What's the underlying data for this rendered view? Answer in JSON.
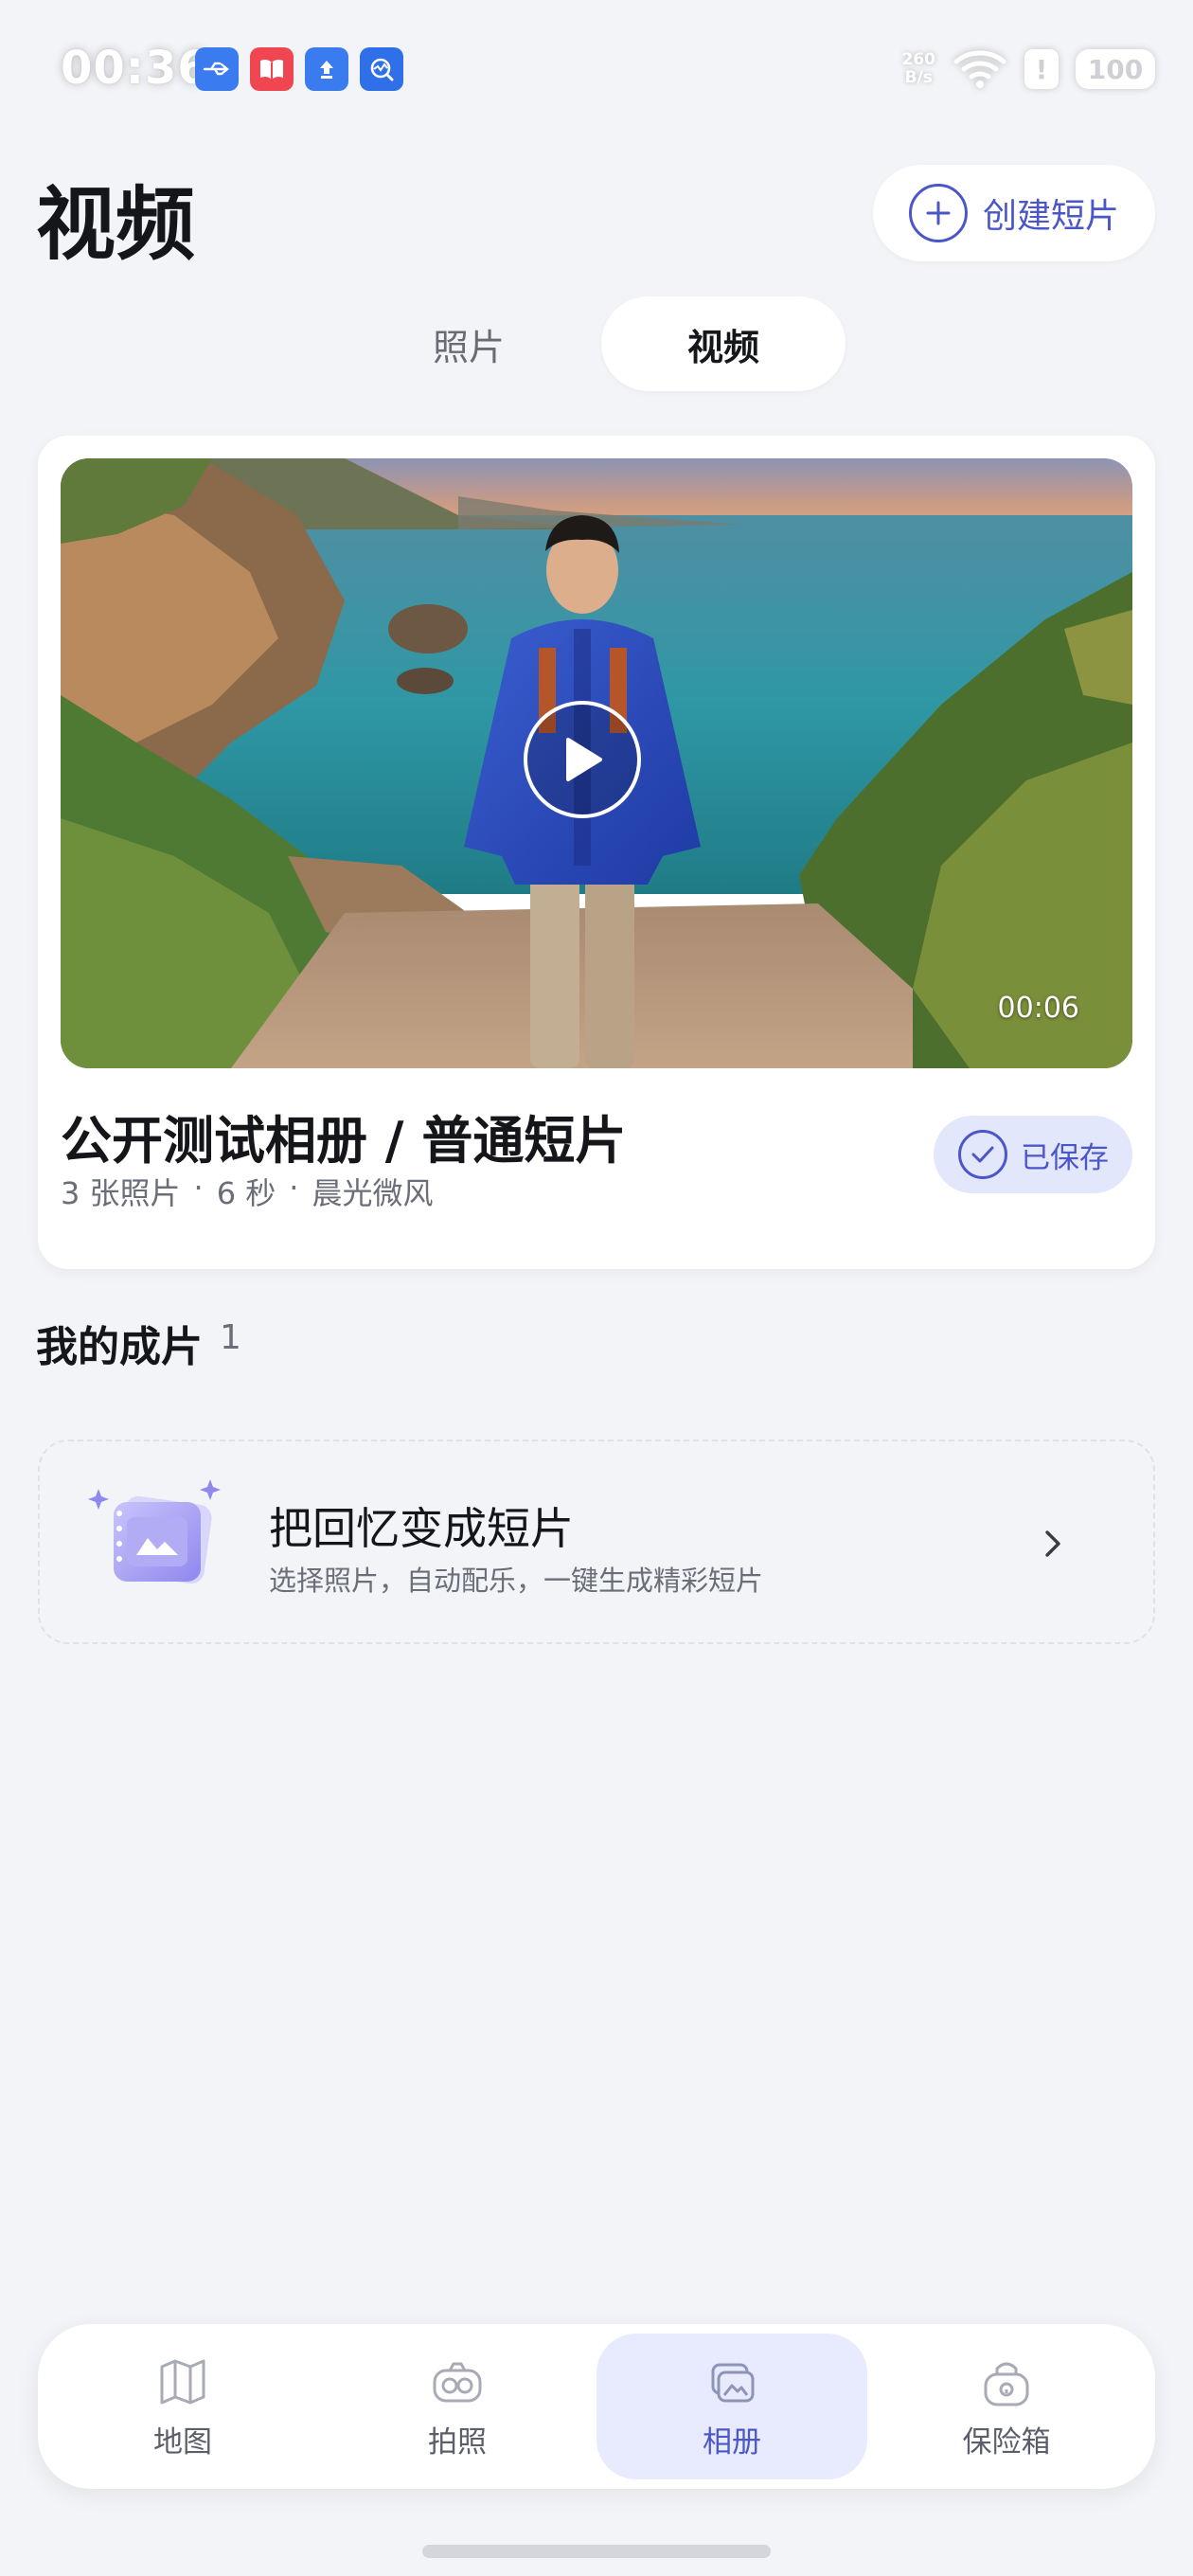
{
  "status_bar": {
    "time": "00:36",
    "net_speed_value": "260",
    "net_speed_unit": "B/s",
    "battery": "100",
    "app_icons": [
      "usb-icon",
      "book-app-icon",
      "upload-app-icon",
      "monitor-app-icon"
    ]
  },
  "header": {
    "title": "视频",
    "create_label": "创建短片"
  },
  "tabs": [
    {
      "label": "照片",
      "active": false
    },
    {
      "label": "视频",
      "active": true
    }
  ],
  "video_card": {
    "duration": "00:06",
    "title": "公开测试相册 / 普通短片",
    "meta": [
      "3 张照片",
      "·",
      "6 秒",
      "·",
      "晨光微风"
    ],
    "saved_label": "已保存"
  },
  "my_clips": {
    "title": "我的成片",
    "count": "1"
  },
  "promo": {
    "title": "把回忆变成短片",
    "subtitle": "选择照片，自动配乐，一键生成精彩短片"
  },
  "bottom_nav": [
    {
      "label": "地图",
      "icon": "map-icon",
      "active": false
    },
    {
      "label": "拍照",
      "icon": "camera-icon",
      "active": false
    },
    {
      "label": "相册",
      "icon": "album-icon",
      "active": true
    },
    {
      "label": "保险箱",
      "icon": "safe-icon",
      "active": false
    }
  ],
  "colors": {
    "accent": "#4b56c9",
    "background": "#f3f4f7",
    "active_pill": "#e8ebfd"
  }
}
